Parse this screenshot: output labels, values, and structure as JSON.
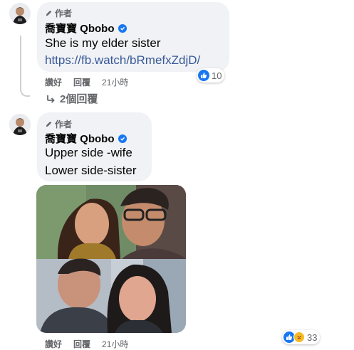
{
  "comment1": {
    "author_tag": "作者",
    "author_name": "喬寶寶 Qbobo",
    "text": "She is my elder sister",
    "link": "https://fb.watch/bRmefxZdjD/",
    "reaction_count": "10",
    "actions": {
      "like": "讚好",
      "reply": "回覆",
      "time": "21小時"
    },
    "replies_label": "2個回覆"
  },
  "comment2": {
    "author_tag": "作者",
    "author_name": "喬寶寶 Qbobo",
    "lines": [
      "Upper side -wife",
      "Lower side-sister"
    ],
    "reaction_count": "33",
    "actions": {
      "like": "讚好",
      "reply": "回覆",
      "time": "21小時"
    }
  },
  "colors": {
    "facebook_blue": "#1877f2",
    "link": "#385898",
    "bubble": "#f0f2f5",
    "meta_text": "#65676b"
  }
}
